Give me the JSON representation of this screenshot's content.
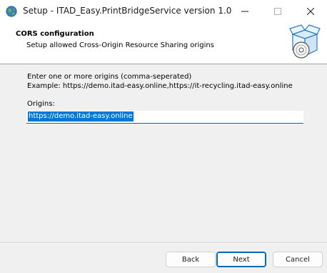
{
  "window": {
    "title": "Setup - ITAD_Easy.PrintBridgeService version 1.0",
    "controls": {
      "minimize": "minimize",
      "maximize": "maximize",
      "close": "close"
    }
  },
  "banner": {
    "title": "CORS configuration",
    "subtitle": "Setup allowed Cross-Origin Resource Sharing origins",
    "icon": "installer-box-disc-icon"
  },
  "form": {
    "instruction_line1": "Enter one or more origins (comma-seperated)",
    "instruction_line2": "Example: https://demo.itad-easy.online,https://it-recycling.itad-easy.online",
    "origins_label": "Origins:",
    "origins_value": "https://demo.itad-easy.online",
    "origins_selected": true
  },
  "footer": {
    "back_label": "Back",
    "next_label": "Next",
    "cancel_label": "Cancel"
  },
  "colors": {
    "accent": "#0067c0",
    "selection": "#0078d7"
  }
}
